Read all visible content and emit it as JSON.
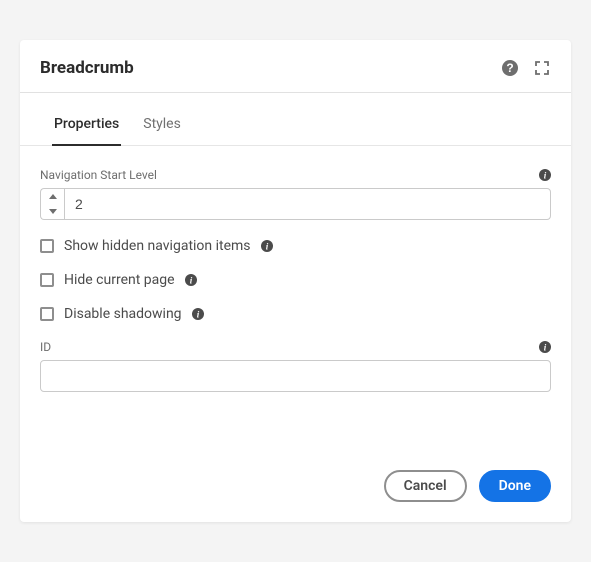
{
  "dialog": {
    "title": "Breadcrumb"
  },
  "tabs": {
    "properties": "Properties",
    "styles": "Styles"
  },
  "fields": {
    "navStartLevel": {
      "label": "Navigation Start Level",
      "value": "2"
    },
    "showHidden": {
      "label": "Show hidden navigation items"
    },
    "hideCurrent": {
      "label": "Hide current page"
    },
    "disableShadowing": {
      "label": "Disable shadowing"
    },
    "id": {
      "label": "ID",
      "value": ""
    }
  },
  "footer": {
    "cancel": "Cancel",
    "done": "Done"
  }
}
